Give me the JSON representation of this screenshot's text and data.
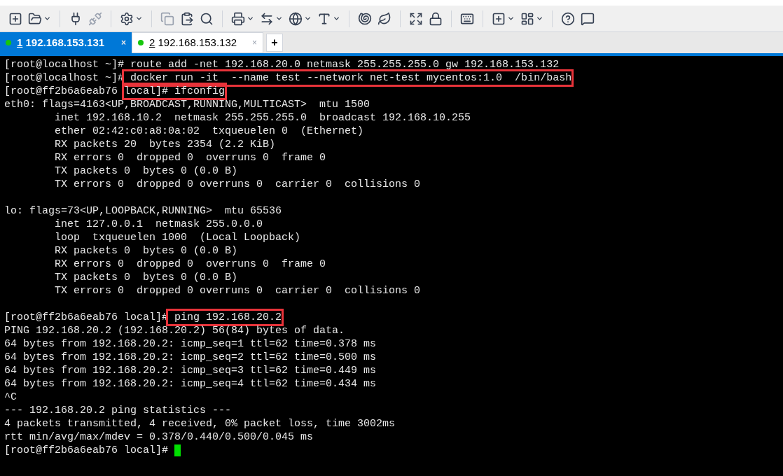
{
  "tabs": [
    {
      "number": "1",
      "label": " 192.168.153.131",
      "selected": true,
      "close": "×"
    },
    {
      "number": "2",
      "label": " 192.168.153.132",
      "selected": false,
      "close": "×"
    }
  ],
  "new_tab": "+",
  "terminal": {
    "blocks": [
      [
        [
          {
            "text": "[root@localhost ~]# route add -net 192.168.20.0 netmask 255.255.255.0 gw 192.168.153.132",
            "boxed": false
          }
        ],
        [
          {
            "text": "[root@localhost ~]#",
            "boxed": false
          },
          {
            "text": " docker run -it  --name test --network net-test mycentos:1.0  /bin/bash",
            "boxed": true
          }
        ],
        [
          {
            "text": "[root@ff2b6a6eab76 ",
            "boxed": false
          },
          {
            "text": "local]# ifconfig",
            "boxed": true
          }
        ],
        [
          {
            "text": "eth0: flags=4163<UP,BROADCAST,RUNNING,MULTICAST>  mtu 1500",
            "boxed": false
          }
        ],
        [
          {
            "text": "        inet 192.168.10.2  netmask 255.255.255.0  broadcast 192.168.10.255",
            "boxed": false
          }
        ],
        [
          {
            "text": "        ether 02:42:c0:a8:0a:02  txqueuelen 0  (Ethernet)",
            "boxed": false
          }
        ],
        [
          {
            "text": "        RX packets 20  bytes 2354 (2.2 KiB)",
            "boxed": false
          }
        ],
        [
          {
            "text": "        RX errors 0  dropped 0  overruns 0  frame 0",
            "boxed": false
          }
        ],
        [
          {
            "text": "        TX packets 0  bytes 0 (0.0 B)",
            "boxed": false
          }
        ],
        [
          {
            "text": "        TX errors 0  dropped 0 overruns 0  carrier 0  collisions 0",
            "boxed": false
          }
        ]
      ],
      [
        [
          {
            "text": "lo: flags=73<UP,LOOPBACK,RUNNING>  mtu 65536",
            "boxed": false
          }
        ],
        [
          {
            "text": "        inet 127.0.0.1  netmask 255.0.0.0",
            "boxed": false
          }
        ],
        [
          {
            "text": "        loop  txqueuelen 1000  (Local Loopback)",
            "boxed": false
          }
        ],
        [
          {
            "text": "        RX packets 0  bytes 0 (0.0 B)",
            "boxed": false
          }
        ],
        [
          {
            "text": "        RX errors 0  dropped 0  overruns 0  frame 0",
            "boxed": false
          }
        ],
        [
          {
            "text": "        TX packets 0  bytes 0 (0.0 B)",
            "boxed": false
          }
        ],
        [
          {
            "text": "        TX errors 0  dropped 0 overruns 0  carrier 0  collisions 0",
            "boxed": false
          }
        ]
      ],
      [
        [
          {
            "text": "[root@ff2b6a6eab76 local]#",
            "boxed": false
          },
          {
            "text": " ping 192.168.20.2",
            "boxed": true
          }
        ],
        [
          {
            "text": "PING 192.168.20.2 (192.168.20.2) 56(84) bytes of data.",
            "boxed": false
          }
        ],
        [
          {
            "text": "64 bytes from 192.168.20.2: icmp_seq=1 ttl=62 time=0.378 ms",
            "boxed": false
          }
        ],
        [
          {
            "text": "64 bytes from 192.168.20.2: icmp_seq=2 ttl=62 time=0.500 ms",
            "boxed": false
          }
        ],
        [
          {
            "text": "64 bytes from 192.168.20.2: icmp_seq=3 ttl=62 time=0.449 ms",
            "boxed": false
          }
        ],
        [
          {
            "text": "64 bytes from 192.168.20.2: icmp_seq=4 ttl=62 time=0.434 ms",
            "boxed": false
          }
        ],
        [
          {
            "text": "^C",
            "boxed": false
          }
        ],
        [
          {
            "text": "--- 192.168.20.2 ping statistics ---",
            "boxed": false
          }
        ],
        [
          {
            "text": "4 packets transmitted, 4 received, 0% packet loss, time 3002ms",
            "boxed": false
          }
        ],
        [
          {
            "text": "rtt min/avg/max/mdev = 0.378/0.440/0.500/0.045 ms",
            "boxed": false
          }
        ],
        [
          {
            "text": "[root@ff2b6a6eab76 local]# ",
            "boxed": false
          }
        ]
      ]
    ]
  }
}
